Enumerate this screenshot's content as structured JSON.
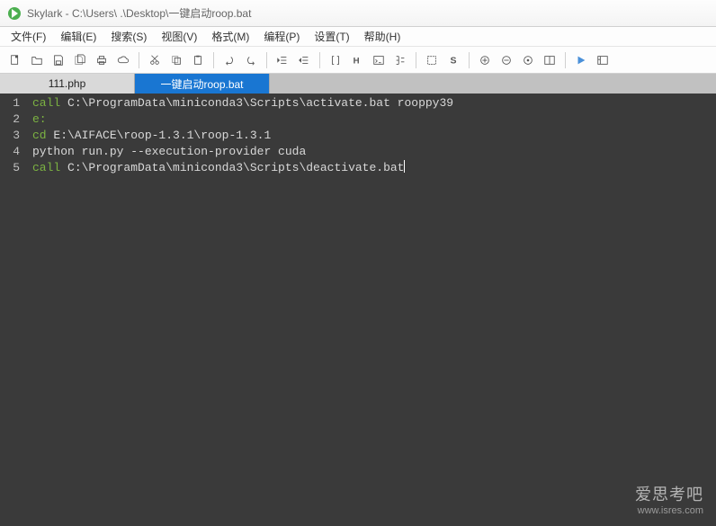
{
  "window": {
    "title": "Skylark - C:\\Users\\  .\\Desktop\\一键启动roop.bat"
  },
  "menu": {
    "file": "文件(F)",
    "edit": "编辑(E)",
    "search": "搜索(S)",
    "view": "视图(V)",
    "format": "格式(M)",
    "code": "编程(P)",
    "settings": "设置(T)",
    "help": "帮助(H)"
  },
  "toolbar_icons": {
    "new": "new",
    "open": "open",
    "save": "save",
    "saveall": "saveall",
    "print": "print",
    "cloud": "cloud",
    "cut": "cut",
    "copy": "copy",
    "paste": "paste",
    "undo": "undo",
    "redo": "redo",
    "indent_left": "indent_left",
    "indent_right": "indent_right",
    "brackets": "brackets",
    "h": "h",
    "code": "code",
    "tree": "tree",
    "rect": "rect",
    "s": "S",
    "sep": "|",
    "zoomin": "zoomin",
    "zoomout": "zoomout",
    "target": "target",
    "pane": "pane",
    "play": "play",
    "exec": "exec"
  },
  "tabs": [
    {
      "label": "111.php",
      "active": false
    },
    {
      "label": "一键启动roop.bat",
      "active": true
    }
  ],
  "code_lines": [
    {
      "n": 1,
      "tokens": [
        {
          "t": "call ",
          "k": true
        },
        {
          "t": "C:\\ProgramData\\miniconda3\\Scripts\\activate.bat rooppy39",
          "k": false
        }
      ]
    },
    {
      "n": 2,
      "tokens": [
        {
          "t": "e:",
          "k": true
        }
      ]
    },
    {
      "n": 3,
      "tokens": [
        {
          "t": "cd ",
          "k": true
        },
        {
          "t": "E:\\AIFACE\\roop-1.3.1\\roop-1.3.1",
          "k": false
        }
      ]
    },
    {
      "n": 4,
      "tokens": [
        {
          "t": "python run.py --execution-provider cuda",
          "k": false
        }
      ]
    },
    {
      "n": 5,
      "tokens": [
        {
          "t": "call ",
          "k": true
        },
        {
          "t": "C:\\ProgramData\\miniconda3\\Scripts\\deactivate.bat",
          "k": false
        }
      ]
    }
  ],
  "watermark": {
    "big": "爱思考吧",
    "small": "www.isres.com"
  }
}
